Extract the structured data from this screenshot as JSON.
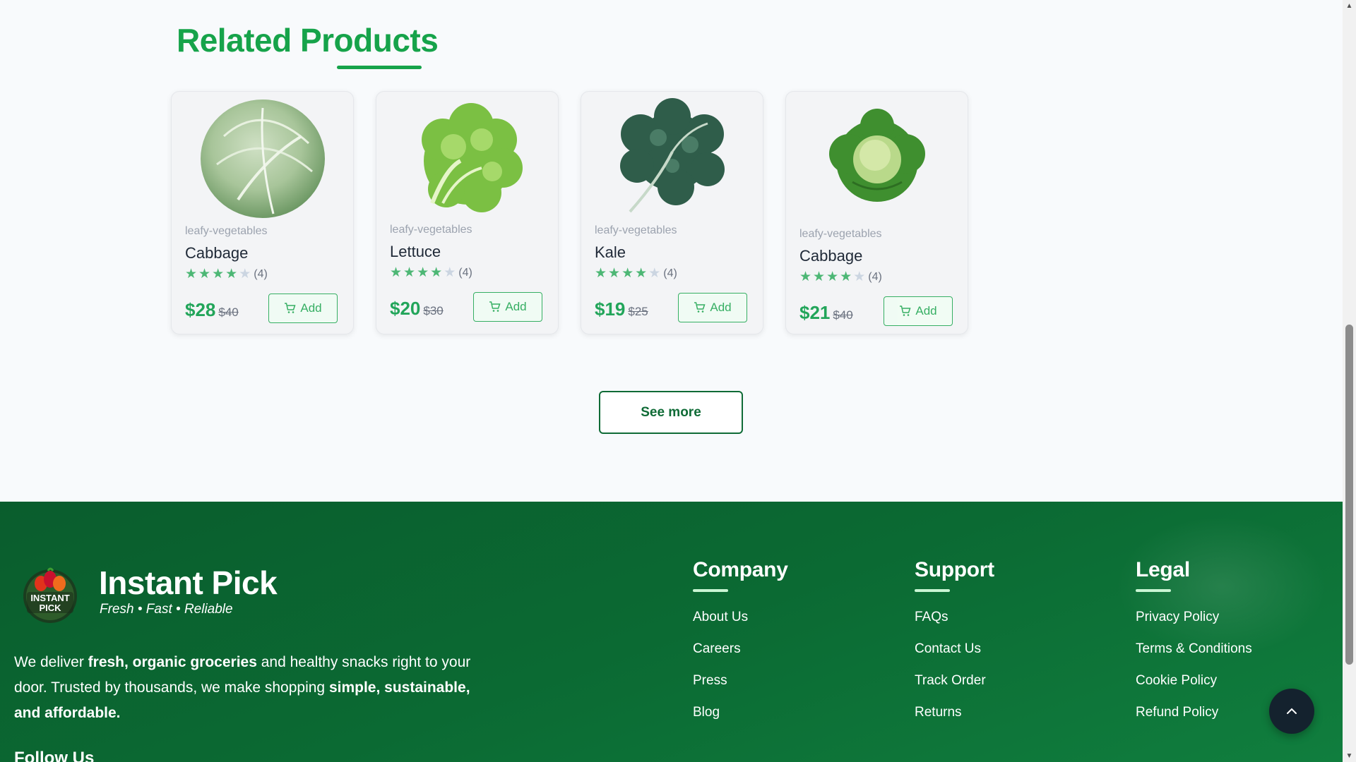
{
  "related": {
    "title": "Related Products",
    "see_more": "See more"
  },
  "products": [
    {
      "category": "leafy-vegetables",
      "name": "Cabbage",
      "rating": 4,
      "review_count": "(4)",
      "price": "$28",
      "old_price": "$40",
      "add_label": "Add",
      "image": "cabbage-image"
    },
    {
      "category": "leafy-vegetables",
      "name": "Lettuce",
      "rating": 4,
      "review_count": "(4)",
      "price": "$20",
      "old_price": "$30",
      "add_label": "Add",
      "image": "lettuce-image"
    },
    {
      "category": "leafy-vegetables",
      "name": "Kale",
      "rating": 4,
      "review_count": "(4)",
      "price": "$19",
      "old_price": "$25",
      "add_label": "Add",
      "image": "kale-image"
    },
    {
      "category": "leafy-vegetables",
      "name": "Cabbage",
      "rating": 4,
      "review_count": "(4)",
      "price": "$21",
      "old_price": "$40",
      "add_label": "Add",
      "image": "cabbage-image"
    }
  ],
  "footer": {
    "brand": "Instant Pick",
    "logo_text_1": "INSTANT",
    "logo_text_2": "PICK",
    "tagline": "Fresh • Fast • Reliable",
    "about": {
      "t1": "We deliver ",
      "b1": "fresh, organic groceries",
      "t2": " and healthy snacks right to your door. Trusted by thousands, we make shopping ",
      "b2": "simple, sustainable, and affordable."
    },
    "follow_title": "Follow Us",
    "columns": [
      {
        "title": "Company",
        "links": [
          "About Us",
          "Careers",
          "Press",
          "Blog"
        ]
      },
      {
        "title": "Support",
        "links": [
          "FAQs",
          "Contact Us",
          "Track Order",
          "Returns"
        ]
      },
      {
        "title": "Legal",
        "links": [
          "Privacy Policy",
          "Terms & Conditions",
          "Cookie Policy",
          "Refund Policy"
        ]
      }
    ]
  },
  "icons": {
    "cart": "cart-icon",
    "back_to_top": "chevron-up-icon"
  },
  "colors": {
    "accent": "#16a34a",
    "footer_bg": "#0b6a33",
    "back_to_top_bg": "#14222e"
  }
}
